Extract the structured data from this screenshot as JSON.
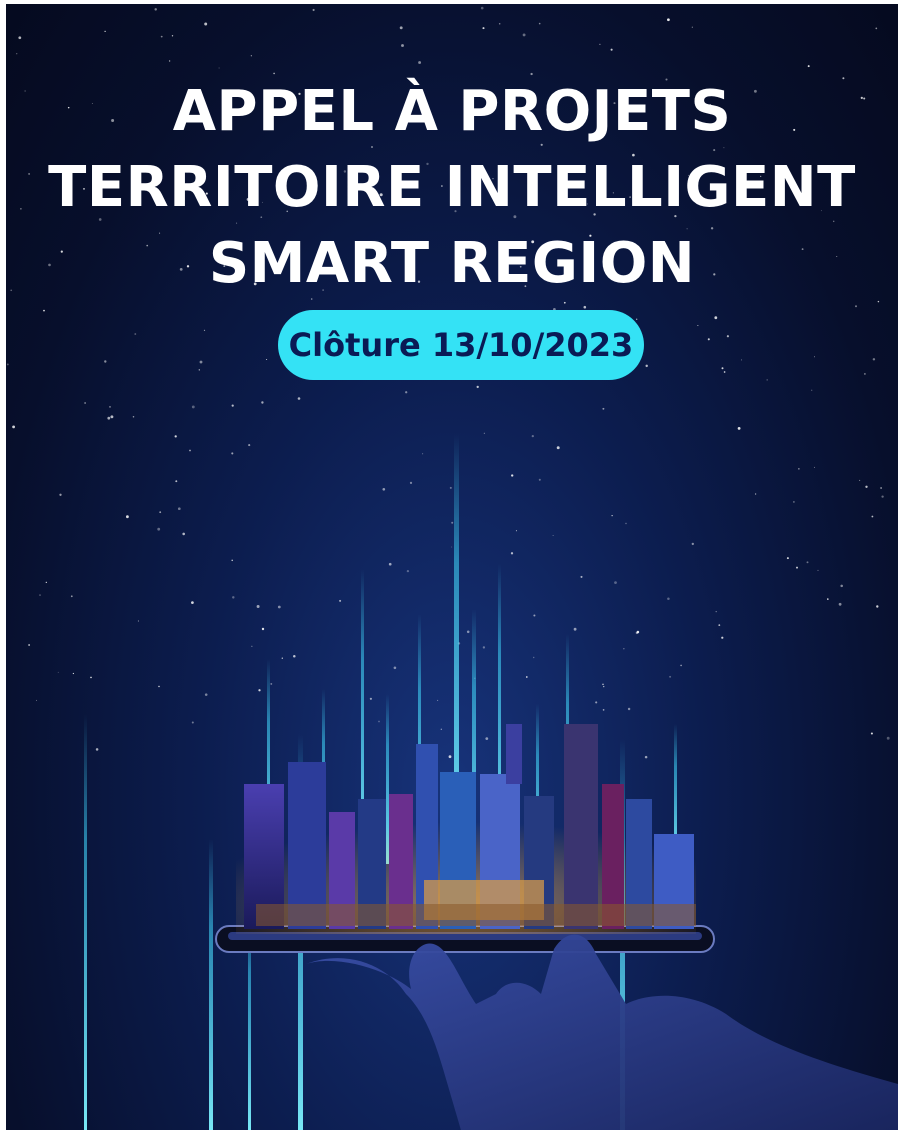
{
  "poster": {
    "title_lines": [
      "APPEL À PROJETS",
      "TERRITOIRE INTELLIGENT",
      "SMART REGION"
    ],
    "deadline_badge": "Clôture 13/10/2023"
  },
  "colors": {
    "background_dark": "#050a1f",
    "background_glow": "#17337a",
    "badge_fill": "#34e2f5",
    "badge_text": "#0a1b55",
    "light_beam": "#5fe8ff"
  },
  "illustration": {
    "subject": "hand holding smartphone with glowing city skyline",
    "icons": [
      "hand-icon",
      "smartphone-icon",
      "city-skyline-icon"
    ]
  }
}
